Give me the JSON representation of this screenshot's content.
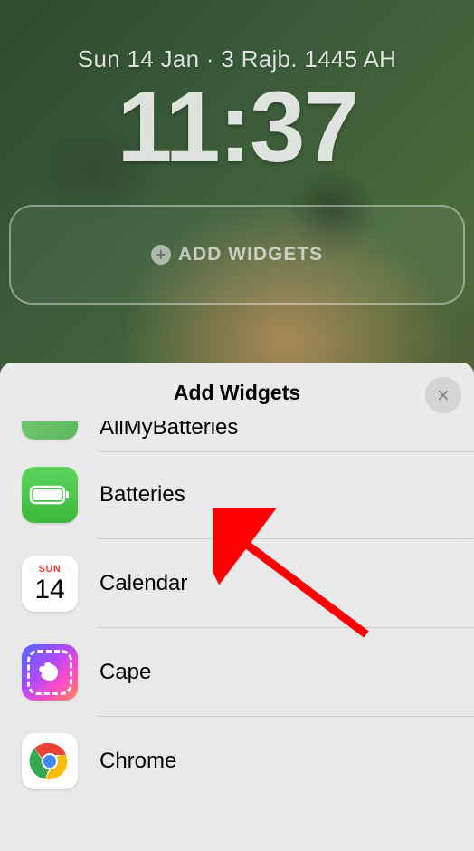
{
  "lock_screen": {
    "date": "Sun 14 Jan · 3 Rajb. 1445 AH",
    "time": "11:37",
    "add_widgets_label": "ADD WIDGETS"
  },
  "sheet": {
    "title": "Add Widgets"
  },
  "calendar_icon": {
    "day": "SUN",
    "date": "14"
  },
  "widgets": {
    "item0": {
      "name": "AllMyBatteries"
    },
    "item1": {
      "name": "Batteries"
    },
    "item2": {
      "name": "Calendar"
    },
    "item3": {
      "name": "Cape"
    },
    "item4": {
      "name": "Chrome"
    }
  }
}
